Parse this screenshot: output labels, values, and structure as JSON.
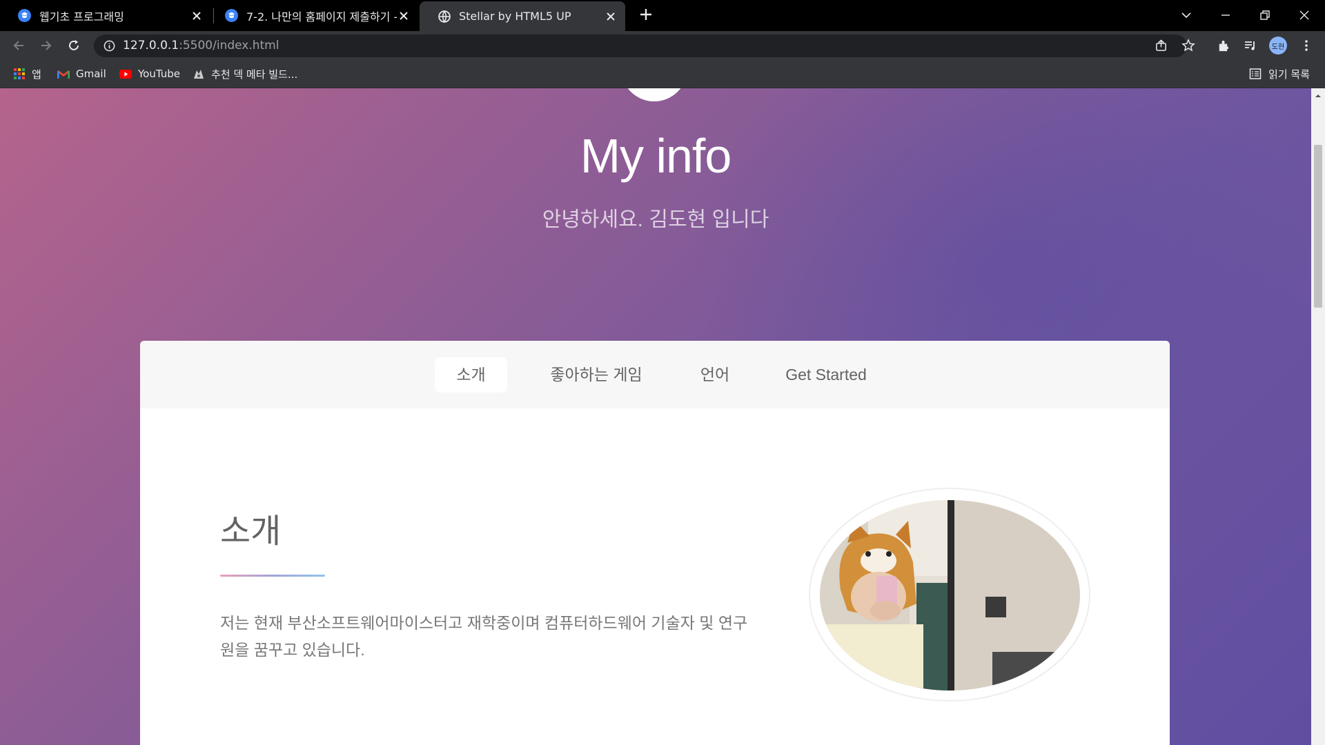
{
  "browser": {
    "tabs": [
      {
        "title": "웹기초 프로그래밍"
      },
      {
        "title": "7-2. 나만의 홈페이지 제출하기 -"
      },
      {
        "title": "Stellar by HTML5 UP"
      }
    ],
    "url_main": "127.0.0.1",
    "url_rest": ":5500/index.html",
    "avatar_label": "도현",
    "bookmarks": [
      {
        "label": "앱",
        "icon": "apps-grid-icon"
      },
      {
        "label": "Gmail",
        "icon": "gmail-icon"
      },
      {
        "label": "YouTube",
        "icon": "youtube-icon"
      },
      {
        "label": "추천 덱 메타 빌드...",
        "icon": "site-icon"
      }
    ],
    "reading_list": "읽기 목록"
  },
  "page": {
    "hero": {
      "title": "My info",
      "subtitle": "안녕하세요. 김도현 입니다"
    },
    "nav": [
      {
        "label": "소개",
        "active": true
      },
      {
        "label": "좋아하는 게임",
        "active": false
      },
      {
        "label": "언어",
        "active": false
      },
      {
        "label": "Get Started",
        "active": false
      }
    ],
    "section": {
      "title": "소개",
      "body": "저는 현재 부산소프트웨어마이스터고 재학중이며 컴퓨터하드웨어 기술자 및 연구원을 꿈꾸고 있습니다."
    }
  }
}
